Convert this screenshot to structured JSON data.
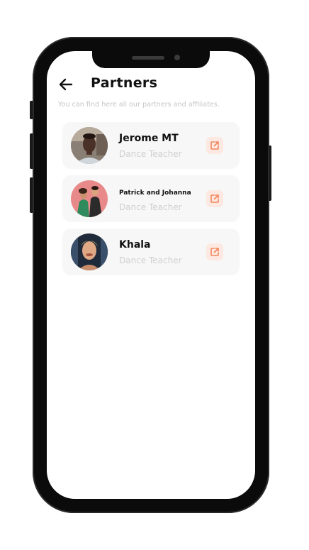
{
  "header": {
    "title": "Partners",
    "subtitle": "You can find here all our partners and affiliates."
  },
  "partners": [
    {
      "name": "Jerome MT",
      "role": "Dance Teacher"
    },
    {
      "name": "Patrick and Johanna",
      "role": "Dance Teacher"
    },
    {
      "name": "Khala",
      "role": "Dance Teacher"
    }
  ],
  "icons": {
    "back": "arrow-left-icon",
    "link": "external-link-icon"
  },
  "colors": {
    "accent": "#f2855c",
    "accent_bg": "#fde9e2",
    "card_bg": "#f7f7f7",
    "muted_text": "#d0d0d0"
  }
}
